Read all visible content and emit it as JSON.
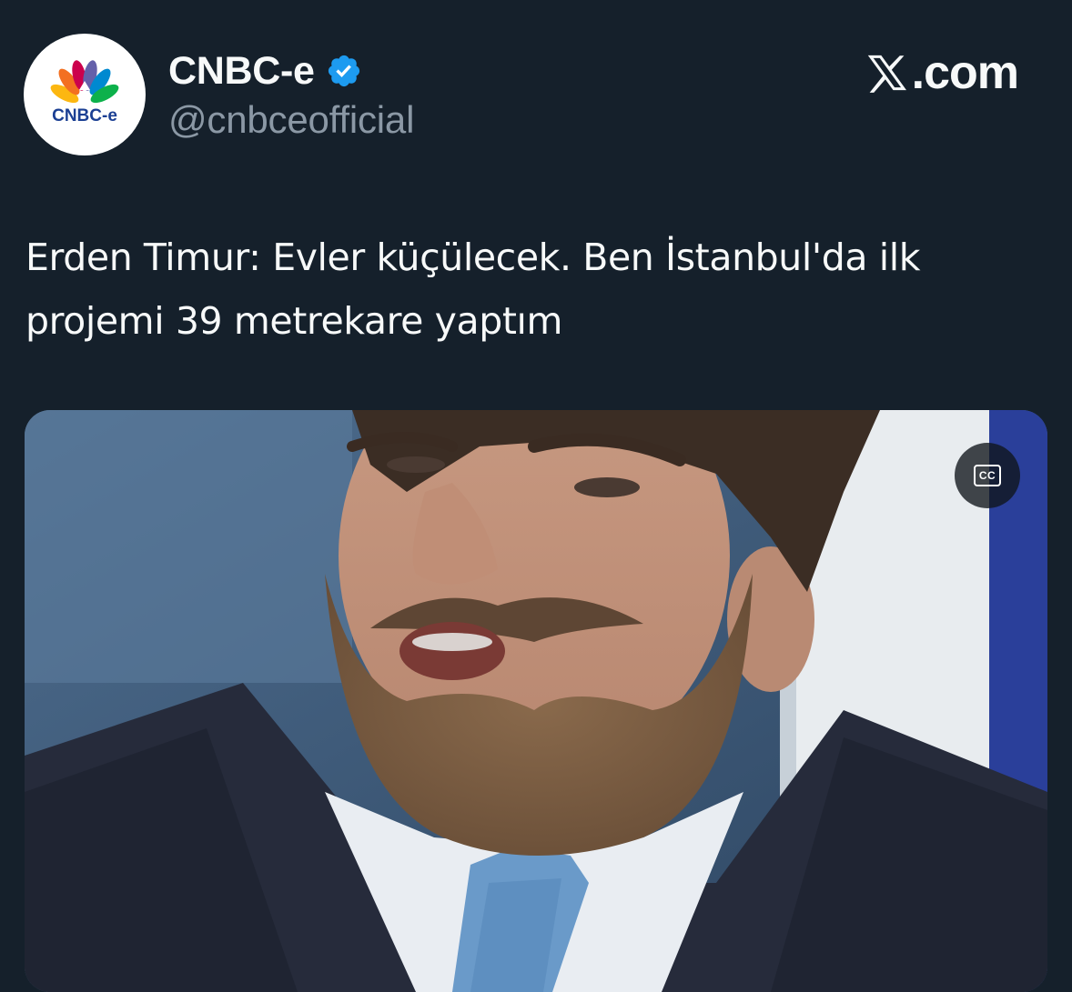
{
  "account": {
    "display_name": "CNBC-e",
    "handle": "@cnbceofficial",
    "verified": true,
    "avatar_logo_text": "CNBC-e"
  },
  "brand": {
    "text": ".com",
    "icon": "x-logo-icon"
  },
  "tweet": {
    "text": "Erden Timur: Evler küçülecek. Ben İstanbul'da ilk projemi 39 metrekare yaptım"
  },
  "media": {
    "type": "video",
    "cc_label": "CC",
    "cc_icon": "closed-captions-icon"
  },
  "colors": {
    "background": "#15202b",
    "verified_badge": "#1d9bf0",
    "handle_text": "#8b98a5"
  }
}
